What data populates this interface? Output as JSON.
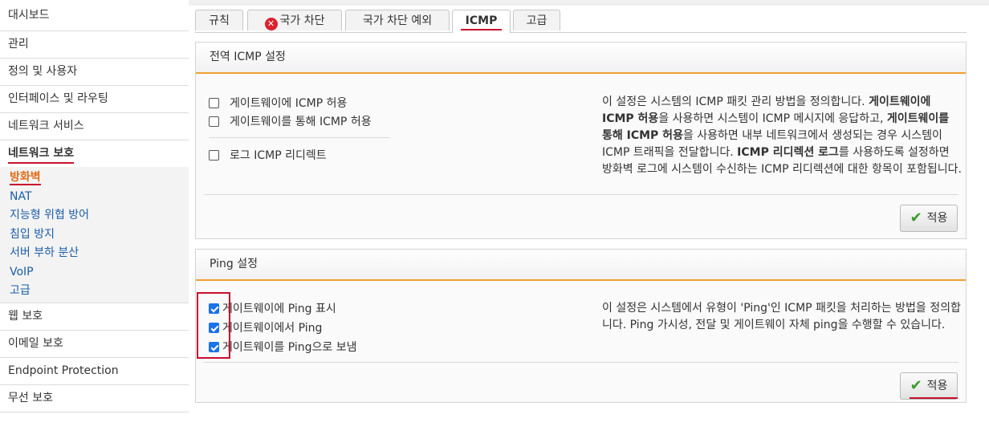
{
  "sidebar": {
    "items": [
      {
        "label": "대시보드"
      },
      {
        "label": "관리"
      },
      {
        "label": "정의 및 사용자"
      },
      {
        "label": "인터페이스 및 라우팅"
      },
      {
        "label": "네트워크 서비스"
      },
      {
        "label": "네트워크 보호"
      }
    ],
    "sub_items": [
      {
        "label": "방화벽"
      },
      {
        "label": "NAT"
      },
      {
        "label": "지능형 위협 방어"
      },
      {
        "label": "침입 방지"
      },
      {
        "label": "서버 부하 분산"
      },
      {
        "label": "VoIP"
      },
      {
        "label": "고급"
      }
    ],
    "items_after": [
      {
        "label": "웹 보호"
      },
      {
        "label": "이메일 보호"
      },
      {
        "label": "Endpoint Protection"
      },
      {
        "label": "무선 보호"
      }
    ]
  },
  "tabs": [
    {
      "label": "규칙"
    },
    {
      "label": "국가 차단",
      "icon": "error-x-icon"
    },
    {
      "label": "국가 차단 예외"
    },
    {
      "label": "ICMP"
    },
    {
      "label": "고급"
    }
  ],
  "icmp_panel": {
    "title": "전역 ICMP 설정",
    "options": [
      {
        "label": "게이트웨이에 ICMP 허용",
        "checked": false
      },
      {
        "label": "게이트웨이를 통해 ICMP 허용",
        "checked": false
      },
      {
        "label": "로그 ICMP 리디렉트",
        "checked": false
      }
    ],
    "desc": {
      "p1": "이 설정은 시스템의 ICMP 패킷 관리 방법을 정의합니다. ",
      "b1": "게이트웨이에 ICMP 허용",
      "p2": "을 사용하면 시스템이 ICMP 메시지에 응답하고, ",
      "b2": "게이트웨이를 통해 ICMP 허용",
      "p3": "을 사용하면 내부 네트워크에서 생성되는 경우 시스템이 ICMP 트래픽을 전달합니다. ",
      "b3": "ICMP 리디렉션 로그",
      "p4": "를 사용하도록 설정하면 방화벽 로그에 시스템이 수신하는 ICMP 리디렉션에 대한 항목이 포함됩니다."
    },
    "apply_label": "적용"
  },
  "ping_panel": {
    "title": "Ping 설정",
    "options": [
      {
        "label": "게이트웨이에 Ping 표시",
        "checked": true
      },
      {
        "label": "게이트웨이에서 Ping",
        "checked": true
      },
      {
        "label": "게이트웨이를 Ping으로 보냄",
        "checked": true
      }
    ],
    "desc": "이 설정은 시스템에서 유형이 'Ping'인 ICMP 패킷을 처리하는 방법을 정의합니다. Ping 가시성, 전달 및 게이트웨이 자체 ping을 수행할 수 있습니다.",
    "apply_label": "적용"
  },
  "colors": {
    "accent_orange": "#f0a030",
    "highlight_red": "#c8102e",
    "link_blue": "#1b5ea8",
    "checkbox_blue": "#1a73e8"
  }
}
